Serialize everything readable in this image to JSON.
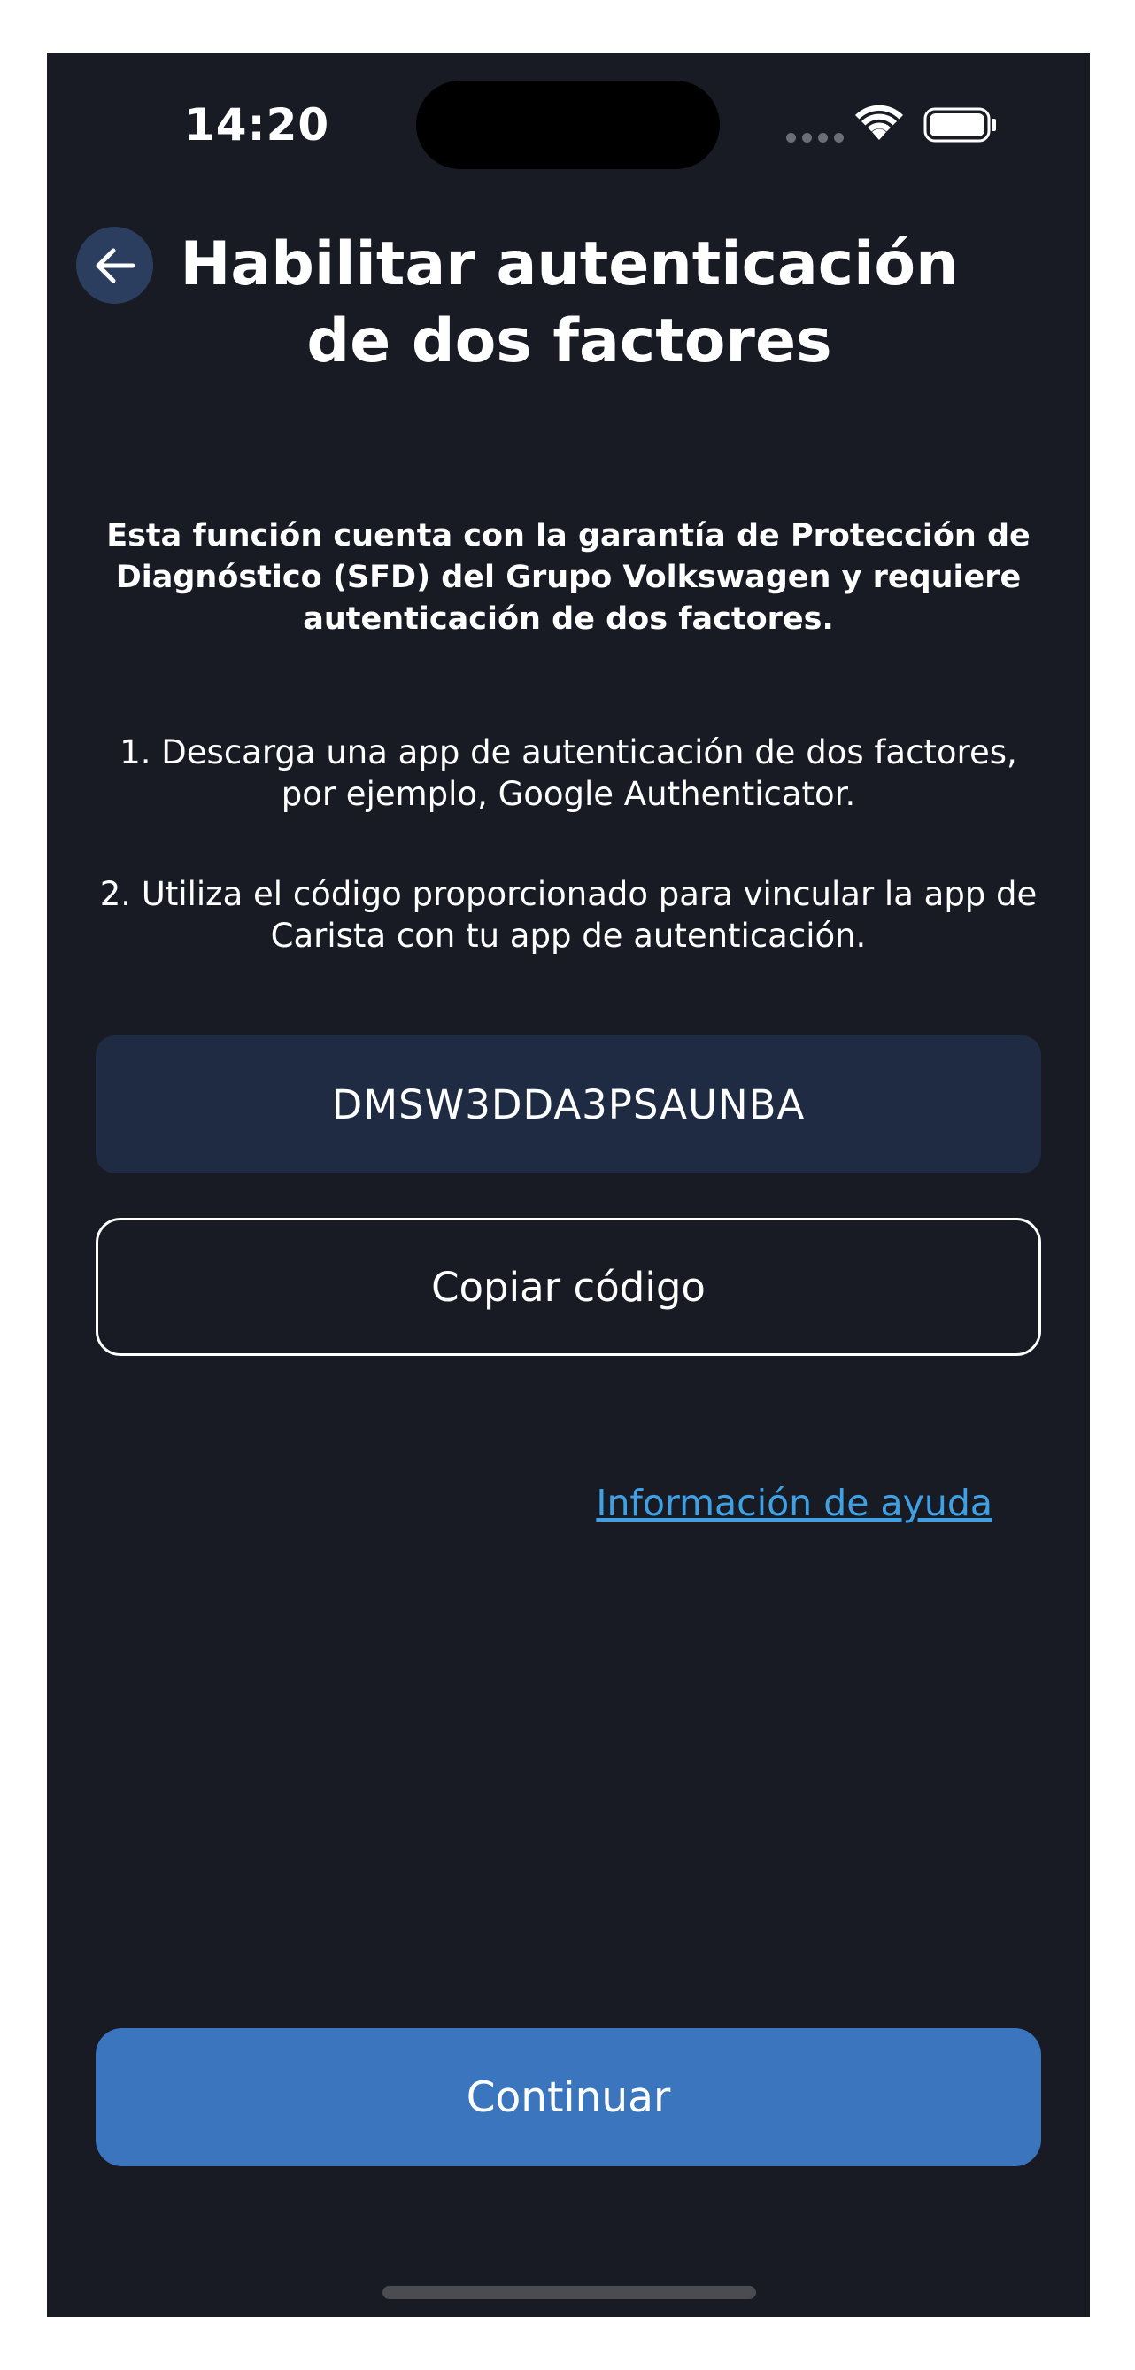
{
  "status_bar": {
    "time": "14:20"
  },
  "header": {
    "back_icon": "arrow-left-icon",
    "title": "Habilitar autenticación de dos factores"
  },
  "content": {
    "intro": "Esta función cuenta con la garantía de Protección de Diagnóstico (SFD) del Grupo Volkswagen y requiere autenticación de dos factores.",
    "steps": [
      "1. Descarga una app de autenticación de dos factores, por ejemplo, Google Authenticator.",
      "2. Utiliza el código proporcionado para vincular la app de Carista con tu app de autenticación."
    ],
    "code": "DMSW3DDA3PSAUNBA",
    "copy_label": "Copiar código",
    "help_link": "Información de ayuda"
  },
  "footer": {
    "continue_label": "Continuar"
  },
  "colors": {
    "background": "#181b24",
    "back_button_bg": "#2b3e5f",
    "code_box_bg": "#1e2b43",
    "link": "#3fa1e3",
    "primary_button": "#3a75bd"
  }
}
